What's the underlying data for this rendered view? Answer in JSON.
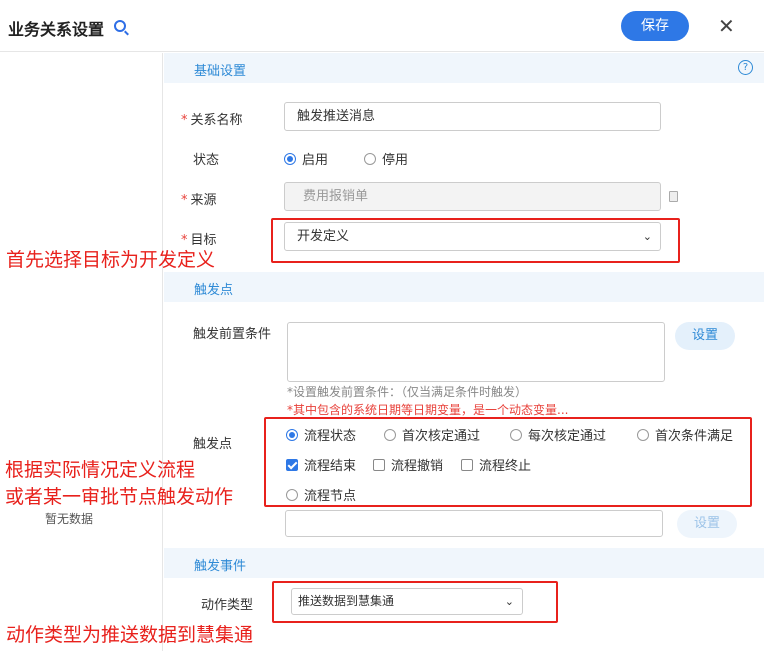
{
  "header": {
    "title": "业务关系设置",
    "save_label": "保存",
    "close_label": "✕"
  },
  "left_panel": {
    "empty_text": "暂无数据"
  },
  "sections": {
    "basic": "基础设置",
    "trigger_point": "触发点",
    "trigger_event": "触发事件"
  },
  "help_label": "?",
  "form": {
    "name_label": "关系名称",
    "name_value": "触发推送消息",
    "status_label": "状态",
    "status_options": [
      "启用",
      "停用"
    ],
    "source_label": "来源",
    "source_placeholder": "费用报销单",
    "target_label": "目标",
    "target_value": "开发定义",
    "precondition_label": "触发前置条件",
    "set_label": "设置",
    "precondition_hint": "*设置触发前置条件：（仅当满足条件时触发）",
    "precondition_warn": "*其中包含的系统日期等日期变量，是一个动态变量...",
    "trigger_point_label": "触发点",
    "trigger_radios": [
      "流程状态",
      "首次核定通过",
      "每次核定通过",
      "首次条件满足"
    ],
    "trigger_checks": [
      "流程结束",
      "流程撤销",
      "流程终止"
    ],
    "trigger_node_label": "流程节点",
    "action_type_label": "动作类型",
    "action_type_value": "推送数据到慧集通",
    "required_mark": "*"
  },
  "annotations": {
    "target": "首先选择目标为开发定义",
    "flow_line1": "根据实际情况定义流程",
    "flow_line2": "或者某一审批节点触发动作",
    "action": "动作类型为推送数据到慧集通"
  },
  "colors": {
    "accent": "#2e78e6",
    "annotation": "#e8211c",
    "section_bg": "#f0f6fc"
  }
}
